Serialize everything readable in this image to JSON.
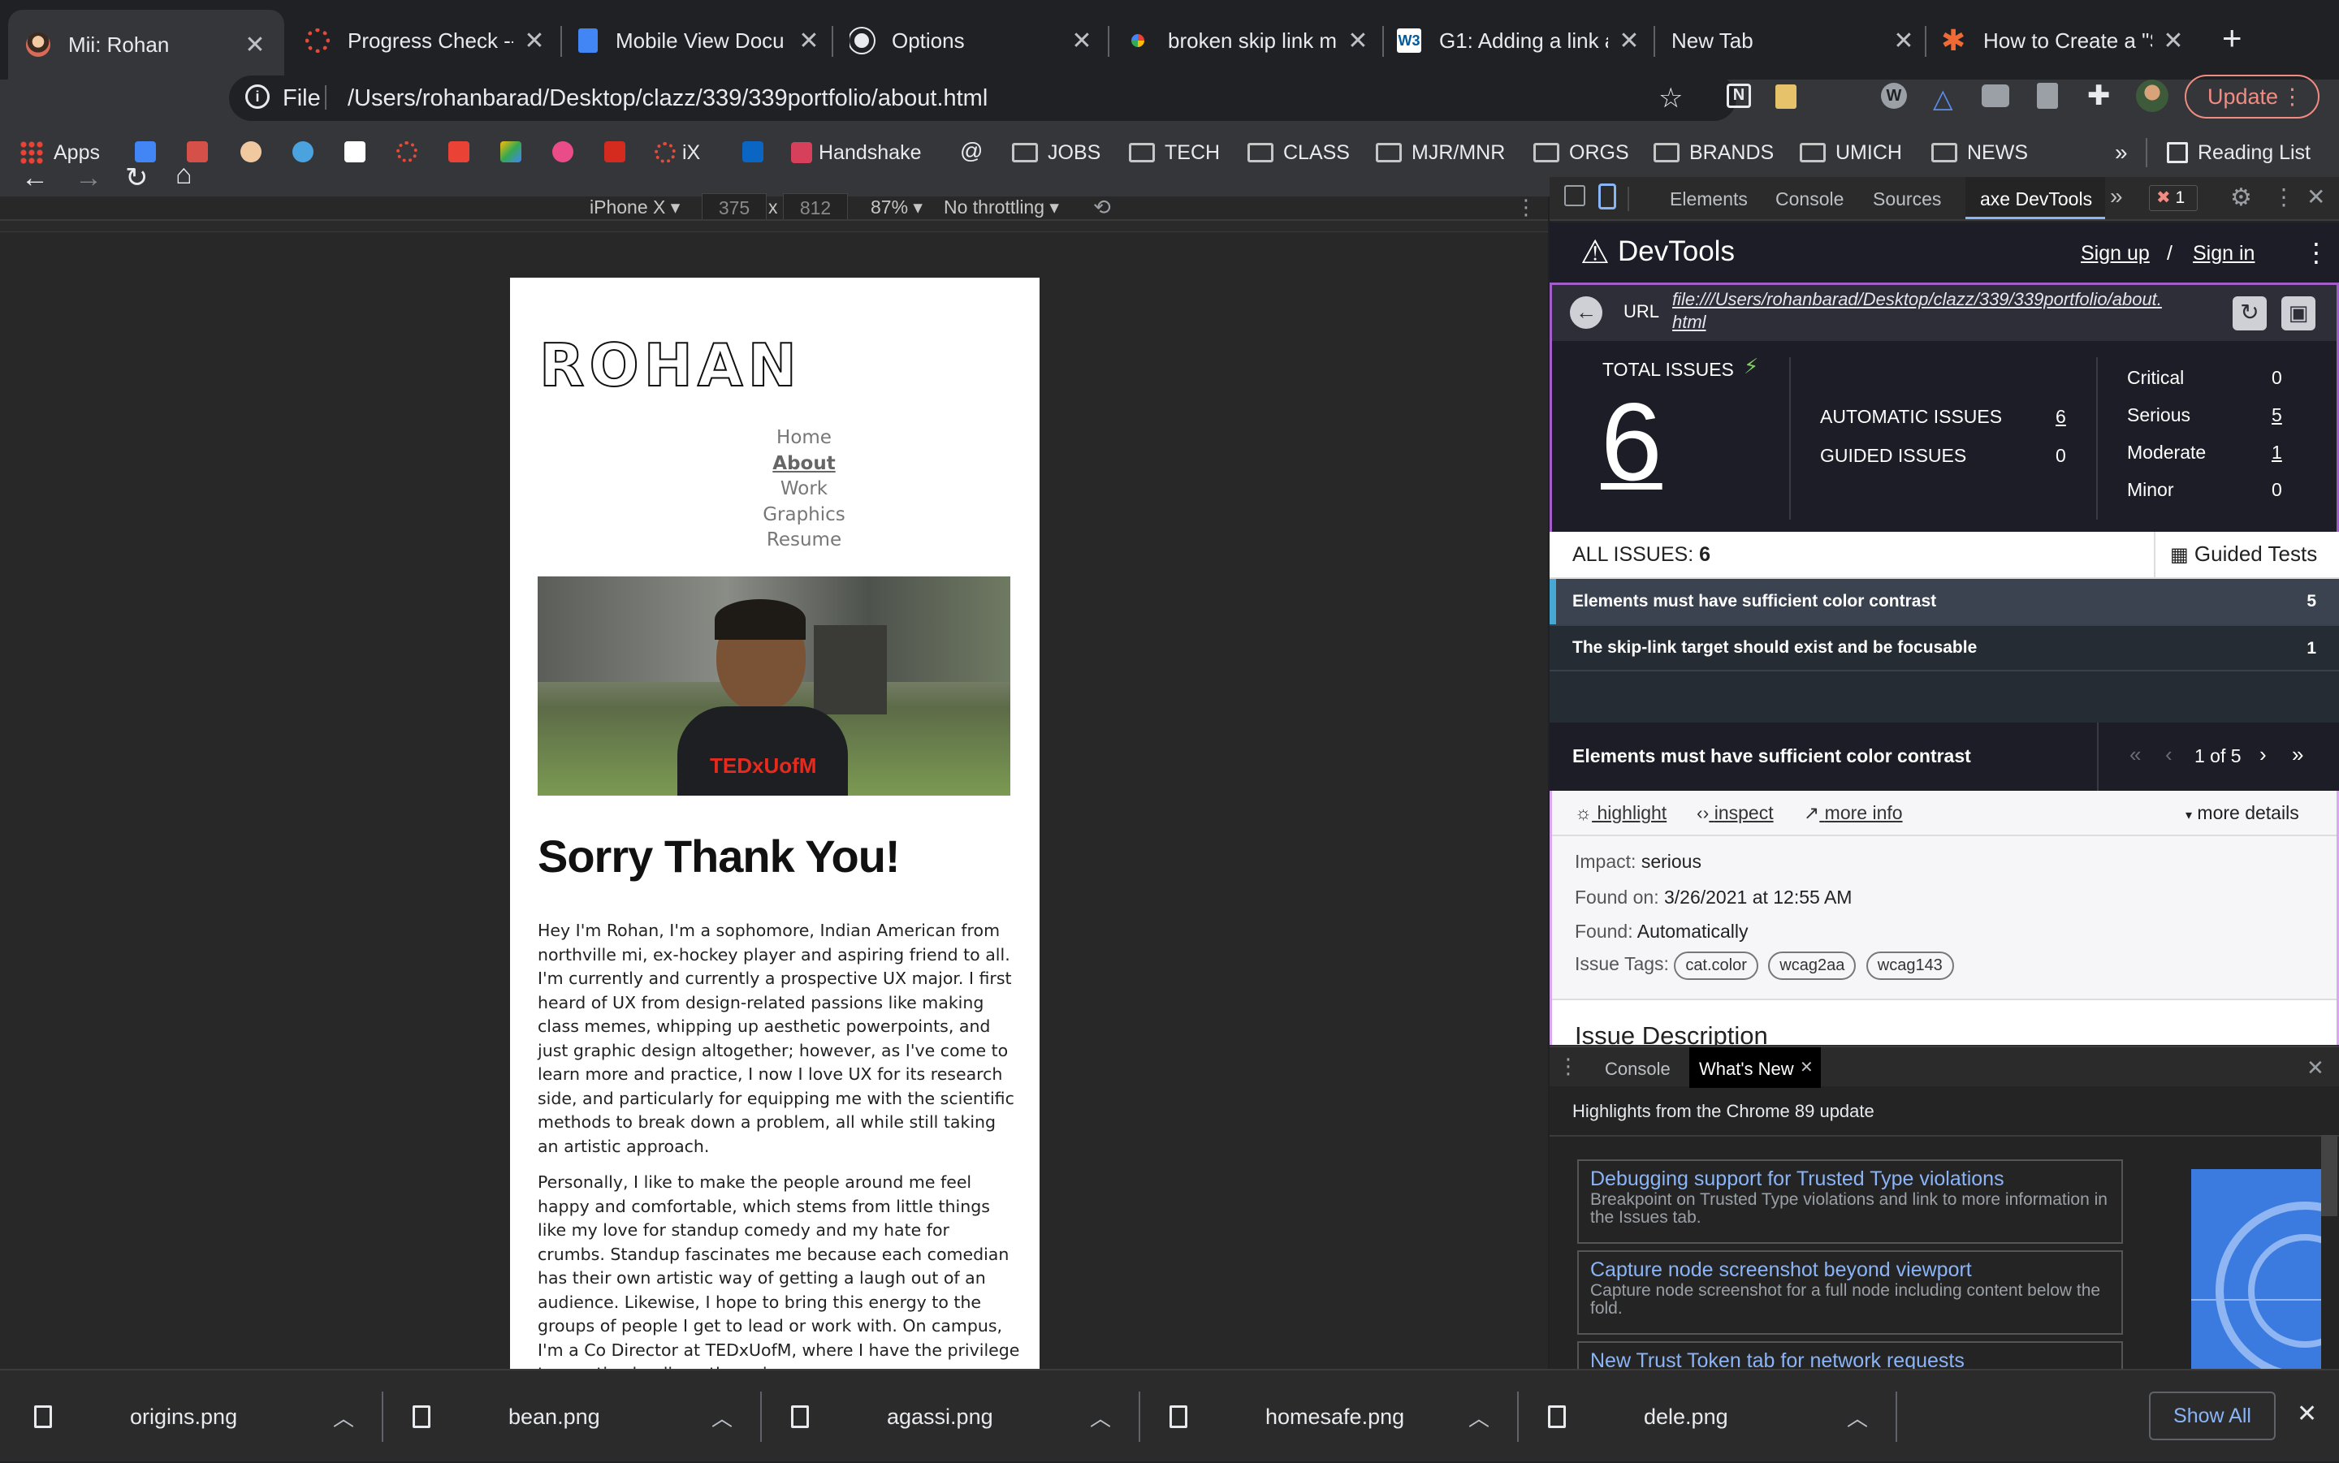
{
  "tabs": [
    {
      "title": "Mii: Rohan",
      "favicon": "avatar",
      "active": true
    },
    {
      "title": "Progress Check --",
      "favicon": "canvas-icon"
    },
    {
      "title": "Mobile View Docu",
      "favicon": "google-docs-icon"
    },
    {
      "title": "Options",
      "favicon": "github-icon"
    },
    {
      "title": "broken skip link m",
      "favicon": "google-icon"
    },
    {
      "title": "G1: Adding a link a",
      "favicon": "w3c-icon"
    },
    {
      "title": "New Tab",
      "favicon": ""
    },
    {
      "title": "How to Create a \"S",
      "favicon": "asterisk-icon"
    }
  ],
  "new_tab_glyph": "+",
  "toolbar": {
    "scheme_label": "File",
    "url": "/Users/rohanbarad/Desktop/clazz/339/339portfolio/about.html",
    "update_label": "Update"
  },
  "bookmarks": {
    "apps": "Apps",
    "ix": "iX",
    "handshake": "Handshake",
    "folders": [
      "JOBS",
      "TECH",
      "CLASS",
      "MJR/MNR",
      "ORGS",
      "BRANDS",
      "UMICH",
      "NEWS"
    ],
    "overflow": "»",
    "reading_list": "Reading List"
  },
  "device_toolbar": {
    "device": "iPhone X",
    "width": "375",
    "times": "x",
    "height": "812",
    "zoom": "87%",
    "throttling": "No throttling"
  },
  "page": {
    "logo": "ROHAN",
    "nav": [
      "Home",
      "About",
      "Work",
      "Graphics",
      "Resume"
    ],
    "active_nav": "About",
    "photo_shirt_text": "TEDxUofM",
    "heading": "Sorry Thank You!",
    "paragraph1": "Hey I'm Rohan, I'm a sophomore, Indian American from northville mi, ex-hockey player and aspiring friend to all. I'm currently and currently a prospective UX major. I first heard of UX from design-related passions like making class memes, whipping up aesthetic powerpoints, and just graphic design altogether; however, as I've come to learn more and practice, I now I love UX for its research side, and particularly for equipping me with the scientific methods to break down a problem, all while still taking an artistic approach.",
    "paragraph2": "Personally, I like to make the people around me feel happy and comfortable, which stems from little things like my love for standup comedy and my hate for crumbs. Standup fascinates me because each comedian has their own artistic way of getting a laugh out of an audience. Likewise, I hope to bring this energy to the groups of people I get to lead or work with. On campus, I'm a Co Director at TEDxUofM, where I have the privilege to practice leading others, in an"
  },
  "devtools": {
    "tabs": [
      "Elements",
      "Console",
      "Sources",
      "axe DevTools"
    ],
    "active_tab": "axe DevTools",
    "overflow": "»",
    "error_count": "1"
  },
  "axe": {
    "brand": "DevTools",
    "sign_up": "Sign up",
    "slash": "/",
    "sign_in": "Sign in",
    "url_label": "URL",
    "url": "file:///Users/rohanbarad/Desktop/clazz/339/339portfolio/about.html",
    "total_label": "TOTAL ISSUES",
    "total": "6",
    "automatic_label": "AUTOMATIC ISSUES",
    "automatic": "6",
    "guided_label": "GUIDED ISSUES",
    "guided": "0",
    "severity": [
      {
        "label": "Critical",
        "count": "0",
        "link": false
      },
      {
        "label": "Serious",
        "count": "5",
        "link": true
      },
      {
        "label": "Moderate",
        "count": "1",
        "link": true
      },
      {
        "label": "Minor",
        "count": "0",
        "link": false
      }
    ],
    "all_issues_label": "ALL ISSUES:",
    "all_issues_count": "6",
    "guided_tests": "Guided Tests",
    "issues": [
      {
        "title": "Elements must have sufficient color contrast",
        "count": "5"
      },
      {
        "title": "The skip-link target should exist and be focusable",
        "count": "1"
      }
    ],
    "detail_title": "Elements must have sufficient color contrast",
    "pager": "1 of 5",
    "highlight": "highlight",
    "inspect": "inspect",
    "more_info": "more info",
    "more_details": "more details",
    "impact_label": "Impact:",
    "impact": "serious",
    "found_on_label": "Found on:",
    "found_on": "3/26/2021 at 12:55 AM",
    "found_label": "Found:",
    "found": "Automatically",
    "tags_label": "Issue Tags:",
    "tags": [
      "cat.color",
      "wcag2aa",
      "wcag143"
    ],
    "issue_description": "Issue Description"
  },
  "drawer": {
    "tabs": [
      "Console",
      "What's New"
    ],
    "active": "What's New",
    "headline": "Highlights from the Chrome 89 update",
    "cards": [
      {
        "title": "Debugging support for Trusted Type violations",
        "desc": "Breakpoint on Trusted Type violations and link to more information in the Issues tab."
      },
      {
        "title": "Capture node screenshot beyond viewport",
        "desc": "Capture node screenshot for a full node including content below the fold."
      },
      {
        "title": "New Trust Token tab for network requests",
        "desc": ""
      }
    ]
  },
  "downloads": {
    "files": [
      "origins.png",
      "bean.png",
      "agassi.png",
      "homesafe.png",
      "dele.png"
    ],
    "show_all": "Show All"
  },
  "colors": {
    "chrome_dark": "#202124",
    "toolbar": "#35363a",
    "axe_navy": "#1d1d27",
    "axe_purple": "#a15ec7",
    "issue_accent": "#49a8d3",
    "update_red": "#f28b82"
  }
}
